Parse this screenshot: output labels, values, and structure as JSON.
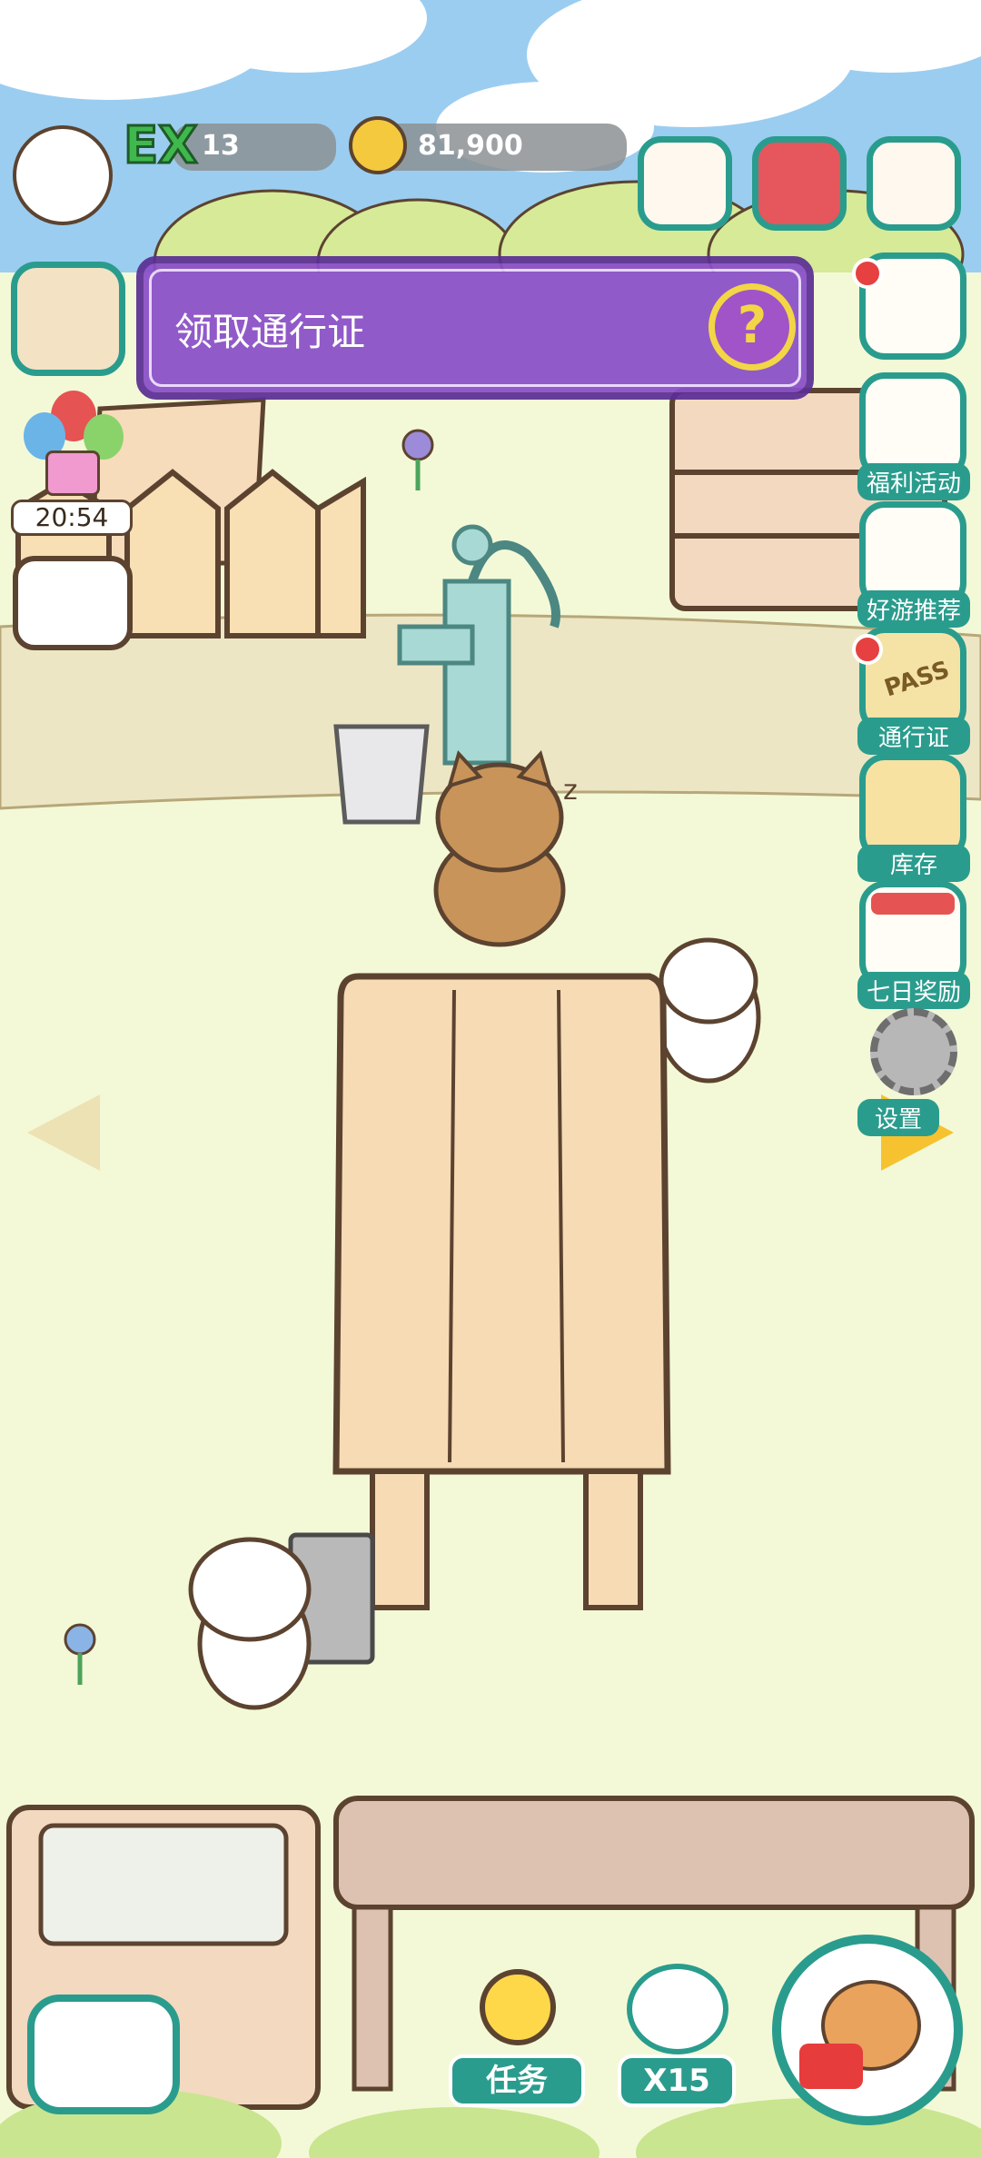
{
  "hud": {
    "level_badge": "EX",
    "level": "13",
    "coins": "81,900"
  },
  "pass_banner": {
    "label": "领取通行证",
    "help": "?"
  },
  "timer": "20:54",
  "side_buttons": [
    {
      "label": "福利活动"
    },
    {
      "label": "好游推荐"
    },
    {
      "label": "通行证",
      "badge": "PASS"
    },
    {
      "label": "库存"
    },
    {
      "label": "七日奖励"
    },
    {
      "label": "设置"
    }
  ],
  "bottom": {
    "tasks_label": "任务",
    "multiplier_label": "X15"
  },
  "colors": {
    "accent": "#2a9c8d",
    "banner": "#8a4fc9",
    "alert": "#e64040"
  },
  "icons": [
    "dog-avatar-icon",
    "paw-coin-icon",
    "shop-icon",
    "cat-book-icon",
    "mailbox-icon",
    "map-icon",
    "balloon-gift-icon",
    "cat-chat-icon",
    "cat-box-icon",
    "cat-phone-icon",
    "pass-ticket-icon",
    "backpack-icon",
    "calendar-icon",
    "gear-icon",
    "arrow-left-icon",
    "arrow-right-icon",
    "lightbulb-icon",
    "storage-box-icon"
  ]
}
